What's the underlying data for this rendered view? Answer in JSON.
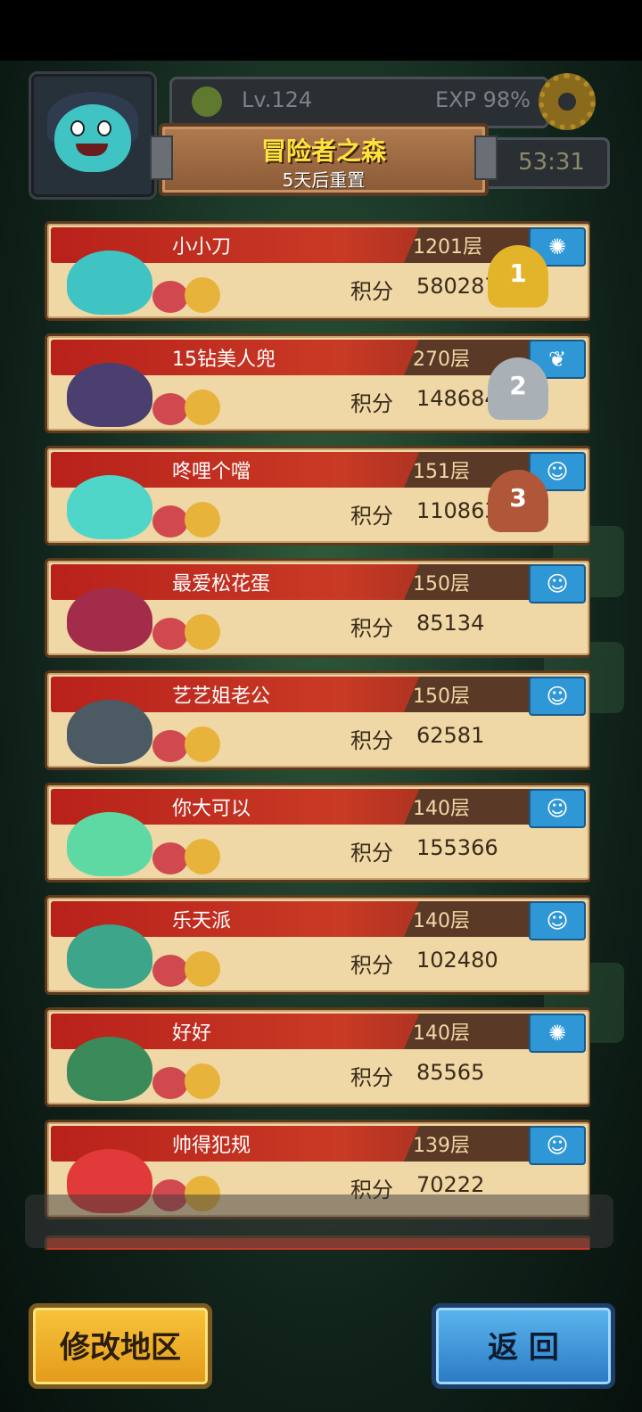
{
  "header": {
    "level": "Lv.124",
    "exp": "EXP 98%",
    "title": "冒险者之森",
    "subtitle": "5天后重置",
    "timer": "53:31"
  },
  "leaderboard": {
    "score_label": "积分",
    "rows": [
      {
        "name": "小小刀",
        "floor": "1201层",
        "score": "580287",
        "rank_badge": "1",
        "trophy": "gold",
        "icon": "spiral-icon",
        "hero_color": "#3fc3c3"
      },
      {
        "name": "15钻美人兜",
        "floor": "270层",
        "score": "148684",
        "rank_badge": "2",
        "trophy": "silver",
        "icon": "wings-icon",
        "hero_color": "#4a3f6e"
      },
      {
        "name": "咚哩个噹",
        "floor": "151层",
        "score": "110863",
        "rank_badge": "3",
        "trophy": "bronze",
        "icon": "slime-icon",
        "hero_color": "#4fd6c9"
      },
      {
        "name": "最爱松花蛋",
        "floor": "150层",
        "score": "85134",
        "rank_badge": "",
        "trophy": "",
        "icon": "slime-icon",
        "hero_color": "#a22c4a"
      },
      {
        "name": "艺艺姐老公",
        "floor": "150层",
        "score": "62581",
        "rank_badge": "",
        "trophy": "",
        "icon": "slime-icon",
        "hero_color": "#4b5a63"
      },
      {
        "name": "你大可以",
        "floor": "140层",
        "score": "155366",
        "rank_badge": "",
        "trophy": "",
        "icon": "slime-icon",
        "hero_color": "#5fd9a3"
      },
      {
        "name": "乐天派",
        "floor": "140层",
        "score": "102480",
        "rank_badge": "",
        "trophy": "",
        "icon": "slime-icon",
        "hero_color": "#3ca58a"
      },
      {
        "name": "好好",
        "floor": "140层",
        "score": "85565",
        "rank_badge": "",
        "trophy": "",
        "icon": "spiral-icon",
        "hero_color": "#3a8a5a"
      },
      {
        "name": "帅得犯规",
        "floor": "139层",
        "score": "70222",
        "rank_badge": "",
        "trophy": "",
        "icon": "slime-icon",
        "hero_color": "#e23a3a"
      }
    ]
  },
  "buttons": {
    "change_region": "修改地区",
    "back": "返 回"
  },
  "colors": {
    "gold": "#e3b42a",
    "silver": "#a9b0b6",
    "bronze": "#b0573a",
    "icon_blue": "#2f97d6"
  }
}
